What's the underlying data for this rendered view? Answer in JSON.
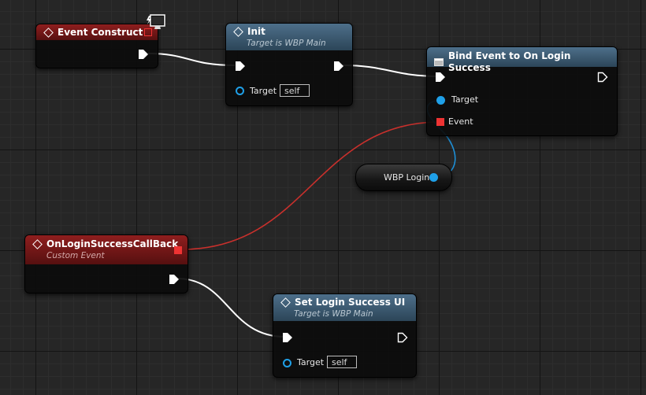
{
  "nodes": {
    "event_construct": {
      "title": "Event Construct"
    },
    "init": {
      "title": "Init",
      "subtitle": "Target is WBP Main",
      "target_label": "Target",
      "target_value": "self"
    },
    "bind_event": {
      "title": "Bind Event to On Login Success",
      "target_label": "Target",
      "event_label": "Event"
    },
    "wbp_login": {
      "label": "WBP Login"
    },
    "callback": {
      "title": "OnLoginSuccessCallBack",
      "subtitle": "Custom Event"
    },
    "set_login_ui": {
      "title": "Set Login Success UI",
      "subtitle": "Target is WBP Main",
      "target_label": "Target",
      "target_value": "self"
    }
  },
  "icons": {
    "event_construct_badge": "client-monitor-icon"
  },
  "colors": {
    "exec_wire": "#ffffff",
    "delegate_wire": "#c8302c",
    "object_wire": "#1e8fd6",
    "event_header": "#7d1a1a",
    "function_header": "#456a84"
  }
}
